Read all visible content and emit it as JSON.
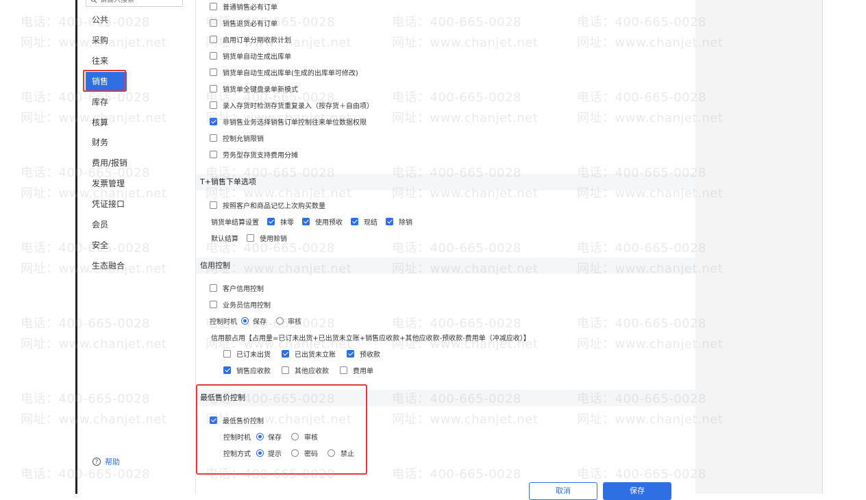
{
  "sidebar": {
    "search_placeholder": "请输入搜索",
    "items": [
      {
        "label": "公共"
      },
      {
        "label": "采购"
      },
      {
        "label": "往来"
      },
      {
        "label": "销售"
      },
      {
        "label": "库存"
      },
      {
        "label": "核算"
      },
      {
        "label": "财务"
      },
      {
        "label": "费用/报销"
      },
      {
        "label": "发票管理"
      },
      {
        "label": "凭证接口"
      },
      {
        "label": "会员"
      },
      {
        "label": "安全"
      },
      {
        "label": "生态融合"
      }
    ],
    "active_item": "销售",
    "help": "帮助"
  },
  "content": {
    "options": [
      {
        "label": "普通销售必有订单",
        "checked": false
      },
      {
        "label": "销售退货必有订单",
        "checked": false
      },
      {
        "label": "启用订单分期收款计划",
        "checked": false
      },
      {
        "label": "销货单自动生成出库单",
        "checked": false
      },
      {
        "label": "销货单自动生成出库单(生成的出库单可修改)",
        "checked": false
      },
      {
        "label": "销货单全键盘录单新模式",
        "checked": false
      },
      {
        "label": "录入存货时检测存货重复录入（按存货＋自由项）",
        "checked": false
      },
      {
        "label": "非销售业务选择销售订单控制往来单位数据权限",
        "checked": true
      },
      {
        "label": "控制允销限销",
        "checked": false
      },
      {
        "label": "劳务型存货支持费用分摊",
        "checked": false
      }
    ],
    "tplus_section": {
      "title": "T+销售下单选项",
      "remember_qty": {
        "label": "按照客户和商品记忆上次购买数量",
        "checked": false
      },
      "settle_label": "销货单结算设置",
      "settle_options": [
        {
          "label": "抹零",
          "checked": true
        },
        {
          "label": "使用预收",
          "checked": true
        },
        {
          "label": "现结",
          "checked": true
        },
        {
          "label": "除销",
          "checked": true
        }
      ],
      "default_settle_label": "默认结算",
      "default_settle_option": {
        "label": "使用赊销",
        "checked": false
      }
    },
    "credit_section": {
      "title": "信用控制",
      "customer_credit": {
        "label": "客户信用控制",
        "checked": false
      },
      "salesman_credit": {
        "label": "业务员信用控制",
        "checked": false
      },
      "timing_label": "控制时机",
      "timing_options": [
        {
          "label": "保存",
          "selected": true
        },
        {
          "label": "审核",
          "selected": false
        }
      ],
      "formula": "信用额占用【占用量=已订未出货+已出货未立账+销售应收款+其他应收款-预收款-费用单（冲减应收）】",
      "components": [
        {
          "label": "已订未出货",
          "checked": false
        },
        {
          "label": "已出货未立账",
          "checked": true
        },
        {
          "label": "预收款",
          "checked": true
        },
        {
          "label": "销售应收款",
          "checked": true
        },
        {
          "label": "其他应收款",
          "checked": false
        },
        {
          "label": "费用单",
          "checked": false
        }
      ]
    },
    "min_price_section": {
      "title": "最低售价控制",
      "enable": {
        "label": "最低售价控制",
        "checked": true
      },
      "timing_label": "控制时机",
      "timing_options": [
        {
          "label": "保存",
          "selected": true
        },
        {
          "label": "审核",
          "selected": false
        }
      ],
      "method_label": "控制方式",
      "method_options": [
        {
          "label": "提示",
          "selected": true
        },
        {
          "label": "密码",
          "selected": false
        },
        {
          "label": "禁止",
          "selected": false
        }
      ]
    }
  },
  "footer": {
    "cancel_label": "取消",
    "save_label": "保存"
  },
  "watermark": {
    "phone": "电话：400-665-0028",
    "site": "网址：www.chanjet.net"
  },
  "colors": {
    "accent": "#2f6fe4",
    "highlight": "#e53935"
  }
}
